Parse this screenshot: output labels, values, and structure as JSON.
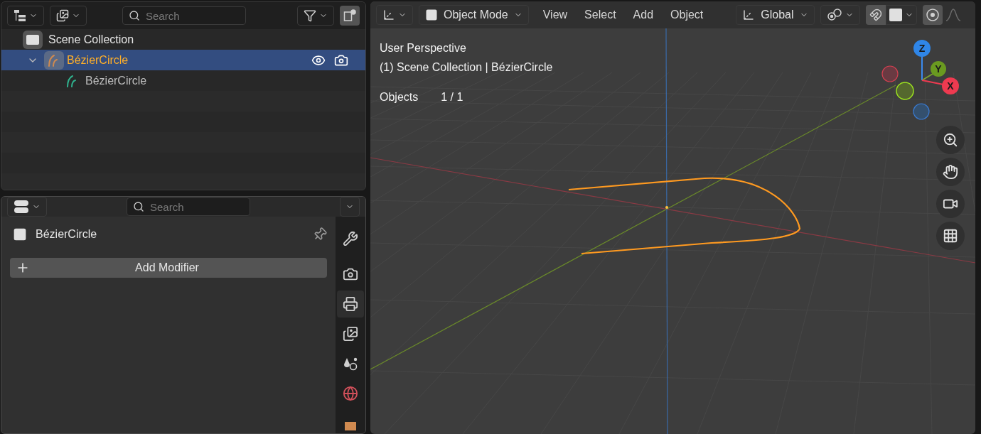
{
  "outliner": {
    "search": {
      "placeholder": "Search"
    },
    "scene_collection": {
      "label": "Scene Collection"
    },
    "items": [
      {
        "label": "BézierCircle",
        "selected": true,
        "expanded": true,
        "children": [
          {
            "label": "BézierCircle"
          }
        ]
      }
    ]
  },
  "properties": {
    "search": {
      "placeholder": "Search"
    },
    "object_name": "BézierCircle",
    "add_button": "Add Modifier",
    "tabs": [
      {
        "kind": "tool",
        "selected": false
      },
      {
        "kind": "render",
        "selected": false
      },
      {
        "kind": "output",
        "selected": true
      },
      {
        "kind": "view_layer",
        "selected": false
      },
      {
        "kind": "scene",
        "selected": false
      },
      {
        "kind": "world",
        "selected": false
      },
      {
        "kind": "object",
        "selected": false
      }
    ]
  },
  "viewport": {
    "mode": "Object Mode",
    "menus": [
      "View",
      "Select",
      "Add",
      "Object"
    ],
    "orientation": "Global",
    "toggles": [
      {
        "kind": "snap",
        "on": true
      },
      {
        "kind": "proportional",
        "on": true
      }
    ],
    "overlay": {
      "view_name": "User Perspective",
      "collection_path": "(1) Scene Collection | BézierCircle",
      "stats_label": "Objects",
      "stats_value": "1 / 1"
    },
    "gizmo": {
      "z": "Z",
      "y": "Y",
      "x": "X"
    }
  }
}
